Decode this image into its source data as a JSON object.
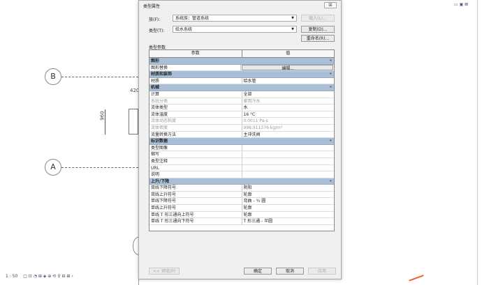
{
  "drawing": {
    "grid_b": "B",
    "grid_a": "A",
    "dim_top": "420",
    "dim_left": "960",
    "scale": "1 : 50",
    "toolbar_icons": "□ ⊡ ◔ ⊞ ◈ ⊕ ⟲ ♀ ⊟ ⊞ ‹"
  },
  "dialog": {
    "title": "类型属性",
    "close": "☒",
    "family_label": "族(F):",
    "family_value": "系统族：管道系统",
    "type_label": "类型(T):",
    "type_value": "给水系统",
    "load_btn": "载入(L)...",
    "duplicate_btn": "复制(D)...",
    "rename_btn": "重命名(R)...",
    "type_params_label": "类型参数",
    "col_param": "参数",
    "col_value": "值",
    "groups": [
      {
        "name": "图形",
        "rows": [
          {
            "p": "图形替换",
            "v": "编辑...",
            "button": true
          }
        ]
      },
      {
        "name": "材质和装饰",
        "rows": [
          {
            "p": "材质",
            "v": "给水管"
          }
        ]
      },
      {
        "name": "机械",
        "rows": [
          {
            "p": "计算",
            "v": "全部"
          },
          {
            "p": "系统分类",
            "v": "家用冷水",
            "gray": true
          },
          {
            "p": "流体类型",
            "v": "水"
          },
          {
            "p": "流体温度",
            "v": "16 °C"
          },
          {
            "p": "流体动态粘度",
            "v": "0.0011 Pa-s",
            "gray": true
          },
          {
            "p": "流体密度",
            "v": "998.911376 kg/m³",
            "gray": true
          },
          {
            "p": "流量转换方法",
            "v": "主冲洗阀"
          }
        ]
      },
      {
        "name": "标识数据",
        "rows": [
          {
            "p": "类型图像",
            "v": ""
          },
          {
            "p": "缩写",
            "v": ""
          },
          {
            "p": "类型注释",
            "v": ""
          },
          {
            "p": "URL",
            "v": ""
          },
          {
            "p": "说明",
            "v": ""
          }
        ]
      },
      {
        "name": "上升/下降",
        "rows": [
          {
            "p": "双线下降符号",
            "v": "阴阳"
          },
          {
            "p": "双线上升符号",
            "v": "轮廓"
          },
          {
            "p": "单线下降符号",
            "v": "弯曲 - ¾ 圆"
          },
          {
            "p": "单线上升符号",
            "v": "轮廓"
          },
          {
            "p": "单线 T 形三通向上符号",
            "v": "轮廓"
          },
          {
            "p": "单线 T 形三通向下符号",
            "v": "T 形三通 - 半圆"
          }
        ]
      }
    ],
    "collapse_icon": "«",
    "preview_btn": "<< 预览(P)",
    "ok_btn": "确定",
    "cancel_btn": "取消",
    "apply_btn": "应用"
  },
  "window_controls": "▭ ▣ ⊠"
}
